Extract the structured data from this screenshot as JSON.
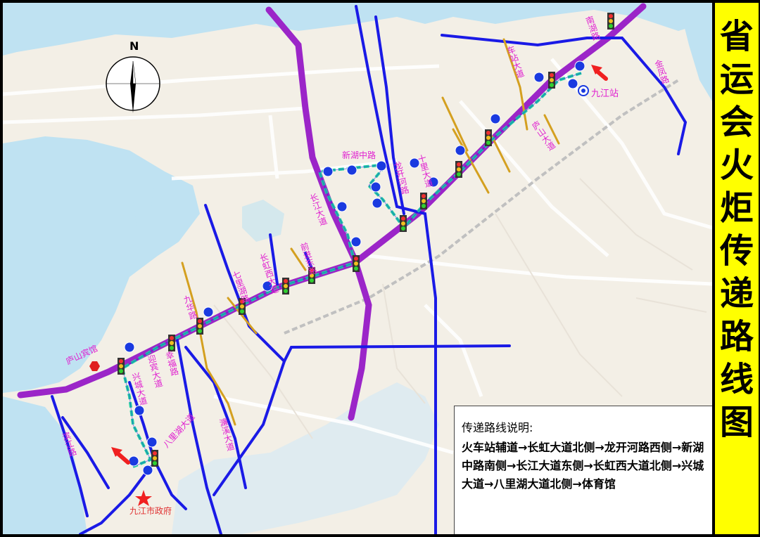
{
  "title": "省运会火炬传递路线图",
  "legend": {
    "title": "传递路线说明:",
    "route": "火车站辅道→长虹大道北侧→龙开河路西侧→新湖中路南侧→长江大道东侧→长虹西大道北侧→兴城大道→八里湖大道北侧→体育馆"
  },
  "compass": {
    "label": "N"
  },
  "places": {
    "station": "九江站",
    "government": "九江市政府",
    "hotel": "庐山宾馆"
  },
  "road_labels": {
    "xinhu": "新湖中路",
    "changjiang": "长江大道",
    "longkaihe": "龙开河路",
    "qiyi": "七里湖路",
    "xingcheng": "兴城大道",
    "balihu": "八里湖大道",
    "jiuhua": "九华路",
    "xingfu": "幸福路",
    "lianxi": "濂溪大道",
    "jinfeng": "金凤路",
    "nanhu": "南湖路",
    "binjiang": "滨江路",
    "yingbin": "迎宾大道",
    "changhong_xi": "长虹西大道",
    "qianjin": "前进东路",
    "shili": "十里大道",
    "lushan": "庐山大道",
    "chezhan": "车站大道"
  },
  "colors": {
    "main_road": "#9b25c8",
    "blue_road": "#1a1ae6",
    "secondary_road": "#d4a020",
    "route": "#20d0a0",
    "water": "#bfe2f2",
    "title_bg": "#ffff00",
    "label": "#e020d0"
  }
}
